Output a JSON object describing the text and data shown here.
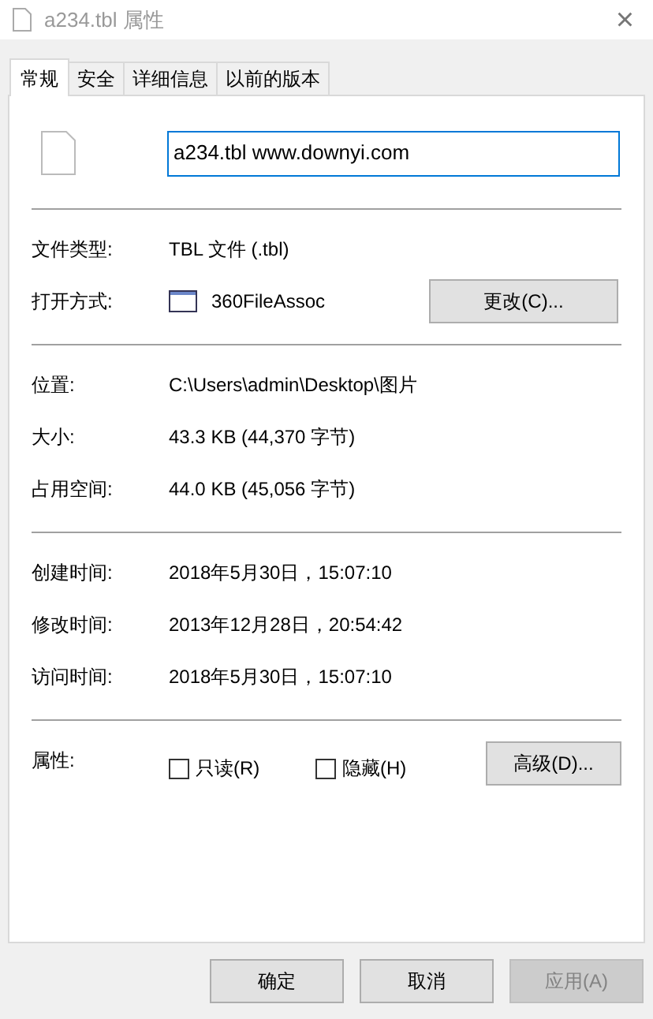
{
  "window": {
    "title": "a234.tbl 属性",
    "close": "×"
  },
  "tabs": [
    {
      "label": "常规",
      "selected": true
    },
    {
      "label": "安全",
      "selected": false
    },
    {
      "label": "详细信息",
      "selected": false
    },
    {
      "label": "以前的版本",
      "selected": false
    }
  ],
  "name_field": {
    "value": "a234.tbl www.downyi.com"
  },
  "groups": [
    [
      {
        "label": "文件类型:",
        "value": "TBL 文件 (.tbl)"
      },
      {
        "label": "打开方式:",
        "value": "360FileAssoc",
        "kind": "app",
        "button": "更改(C)..."
      }
    ],
    [
      {
        "label": "位置:",
        "value": "C:\\Users\\admin\\Desktop\\图片"
      },
      {
        "label": "大小:",
        "value": "43.3 KB (44,370 字节)"
      },
      {
        "label": "占用空间:",
        "value": "44.0 KB (45,056 字节)"
      }
    ],
    [
      {
        "label": "创建时间:",
        "value": "2018年5月30日，15:07:10"
      },
      {
        "label": "修改时间:",
        "value": "2013年12月28日，20:54:42"
      },
      {
        "label": "访问时间:",
        "value": "2018年5月30日，15:07:10"
      }
    ]
  ],
  "attributes": {
    "label": "属性:",
    "checkboxes": [
      {
        "label": "只读(R)",
        "checked": false
      },
      {
        "label": "隐藏(H)",
        "checked": false
      }
    ],
    "button": "高级(D)..."
  },
  "buttons": [
    {
      "label": "确定",
      "disabled": false
    },
    {
      "label": "取消",
      "disabled": false
    },
    {
      "label": "应用(A)",
      "disabled": true
    }
  ]
}
